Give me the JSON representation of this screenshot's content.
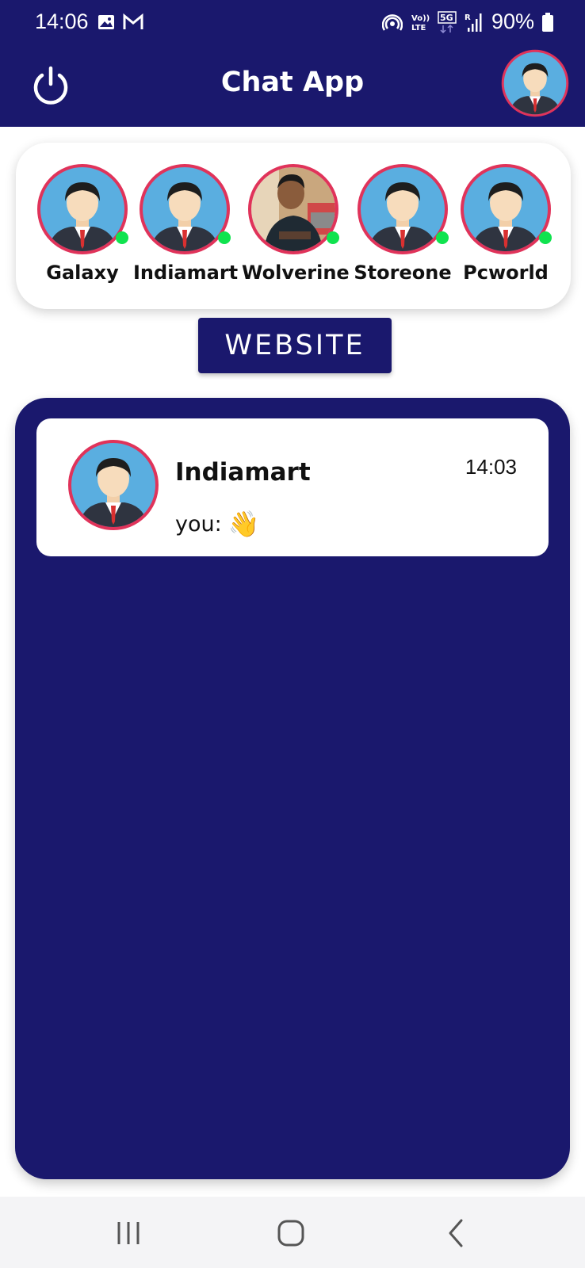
{
  "status_bar": {
    "time": "14:06",
    "battery": "90%",
    "icons": [
      "gallery-icon",
      "gmail-icon",
      "hotspot-icon",
      "volte-icon",
      "5g-icon",
      "signal-icon",
      "battery-icon"
    ]
  },
  "header": {
    "title": "Chat App",
    "power_icon": "power-icon",
    "profile_icon": "avatar"
  },
  "stories": [
    {
      "name": "Galaxy",
      "online": true,
      "photo": false
    },
    {
      "name": "Indiamart",
      "online": true,
      "photo": false
    },
    {
      "name": "Wolverine",
      "online": true,
      "photo": true
    },
    {
      "name": "Storeone",
      "online": true,
      "photo": false
    },
    {
      "name": "Pcworld",
      "online": true,
      "photo": false
    }
  ],
  "website_button": "WEBSITE",
  "chats": [
    {
      "name": "Indiamart",
      "time": "14:03",
      "preview": "you:",
      "emoji": "👋"
    }
  ],
  "colors": {
    "primary": "#1a186d",
    "avatar_ring": "#e0335a",
    "online": "#10e34f",
    "avatar_bg": "#5aaee0"
  },
  "nav": [
    "recent-apps-icon",
    "home-icon",
    "back-icon"
  ]
}
